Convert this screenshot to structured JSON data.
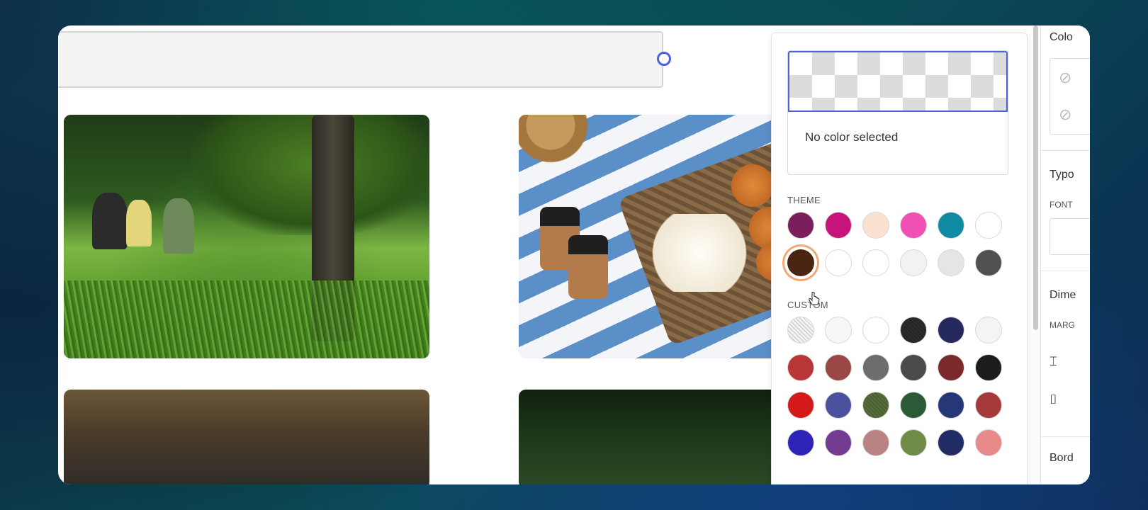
{
  "picker": {
    "status_text": "No color selected",
    "theme_label": "THEME",
    "custom_label": "CUSTOM",
    "theme_swatches": [
      {
        "name": "purple",
        "color": "#7a1e5c"
      },
      {
        "name": "magenta",
        "color": "#c8137a"
      },
      {
        "name": "peach",
        "color": "#fbe2d0"
      },
      {
        "name": "pink",
        "color": "#f04fb3"
      },
      {
        "name": "teal",
        "color": "#0f8aa2"
      },
      {
        "name": "white",
        "color": "#ffffff"
      },
      {
        "name": "dark-brown",
        "color": "#4a2511",
        "selected": true
      },
      {
        "name": "white-2",
        "color": "#ffffff"
      },
      {
        "name": "white-3",
        "color": "#ffffff"
      },
      {
        "name": "light-gray",
        "color": "#f2f2f2"
      },
      {
        "name": "gray",
        "color": "#e5e5e5"
      },
      {
        "name": "charcoal",
        "color": "#515151"
      }
    ],
    "custom_swatches": [
      {
        "name": "light-pattern",
        "color": "#f2f2f2"
      },
      {
        "name": "off-white",
        "color": "#f7f7f7"
      },
      {
        "name": "white",
        "color": "#ffffff"
      },
      {
        "name": "black-pattern",
        "color": "#2a2a2a"
      },
      {
        "name": "navy",
        "color": "#25295e"
      },
      {
        "name": "whitesmoke",
        "color": "#f4f4f4"
      },
      {
        "name": "red",
        "color": "#b93637"
      },
      {
        "name": "rose-brown",
        "color": "#9a4846"
      },
      {
        "name": "gray",
        "color": "#6d6d6d"
      },
      {
        "name": "dark-gray",
        "color": "#4b4b4b"
      },
      {
        "name": "maroon",
        "color": "#7a2a2a"
      },
      {
        "name": "black",
        "color": "#1c1c1c"
      },
      {
        "name": "bright-red",
        "color": "#d51818"
      },
      {
        "name": "slate-blue",
        "color": "#4a52a0"
      },
      {
        "name": "olive-pattern",
        "color": "#556b3a"
      },
      {
        "name": "forest-green",
        "color": "#2d5a36"
      },
      {
        "name": "royal-navy",
        "color": "#263778"
      },
      {
        "name": "brick",
        "color": "#a53a3a"
      },
      {
        "name": "blue-violet",
        "color": "#2f22b7"
      },
      {
        "name": "plum",
        "color": "#743c91"
      },
      {
        "name": "dusty-rose",
        "color": "#b98384"
      },
      {
        "name": "olive-green",
        "color": "#6f8c46"
      },
      {
        "name": "midnight",
        "color": "#222d66"
      },
      {
        "name": "salmon",
        "color": "#e98a8a"
      }
    ]
  },
  "props_panel": {
    "color_heading": "Colo",
    "typography_heading": "Typo",
    "font_label": "FONT",
    "dimensions_heading": "Dime",
    "margin_label": "MARG",
    "border_heading": "Bord"
  }
}
